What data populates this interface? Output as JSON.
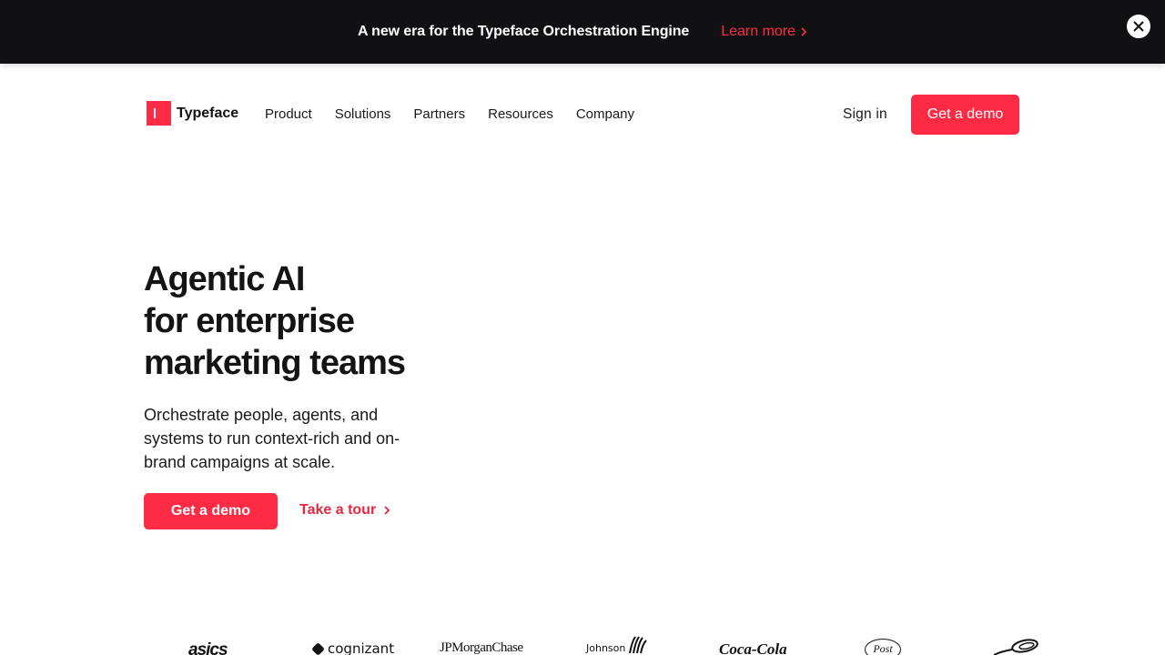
{
  "banner": {
    "text": "A new era for the Typeface Orchestration Engine",
    "link": "Learn more"
  },
  "nav": {
    "logo_text": "Typeface",
    "links": [
      "Product",
      "Solutions",
      "Partners",
      "Resources",
      "Company"
    ],
    "sign_in": "Sign in",
    "demo": "Get a demo"
  },
  "hero": {
    "title_lines": [
      "Agentic AI",
      "for enterprise",
      "marketing teams"
    ],
    "subtitle": "Orchestrate people, agents, and systems to run context-rich and on-brand campaigns at scale.",
    "primary_cta": "Get a demo",
    "secondary_cta": "Take a tour"
  },
  "logos": [
    "asics",
    "cognizant",
    "JPMorganChase",
    "Johnson",
    "Coca-Cola",
    "Post"
  ],
  "colors": {
    "accent": "#ff2a44",
    "banner_bg": "#111113"
  }
}
